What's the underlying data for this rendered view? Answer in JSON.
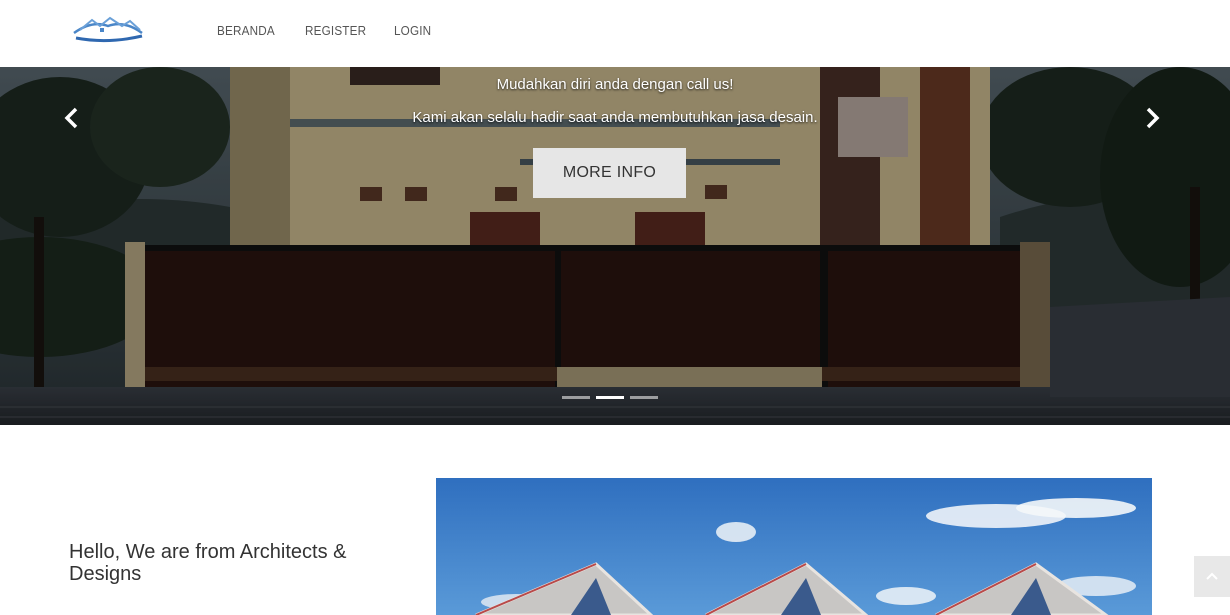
{
  "nav": {
    "logo_icon": "house-roof-logo-icon",
    "links": [
      "BERANDA",
      "REGISTER",
      "LOGIN"
    ]
  },
  "hero": {
    "caption_line1": "Mudahkan diri anda dengan call us!",
    "caption_line2": "Kami akan selalu hadir saat anda membutuhkan jasa desain.",
    "button_label": "MORE INFO",
    "prev_icon": "chevron-left-icon",
    "next_icon": "chevron-right-icon",
    "slide_count": 3,
    "active_slide": 2
  },
  "about": {
    "title": "Hello, We are from Architects & Designs"
  },
  "colors": {
    "button_bg": "#e6e6e6",
    "nav_text": "#555555",
    "sky": "#3a7cc8"
  },
  "back_to_top_icon": "chevron-up-icon"
}
